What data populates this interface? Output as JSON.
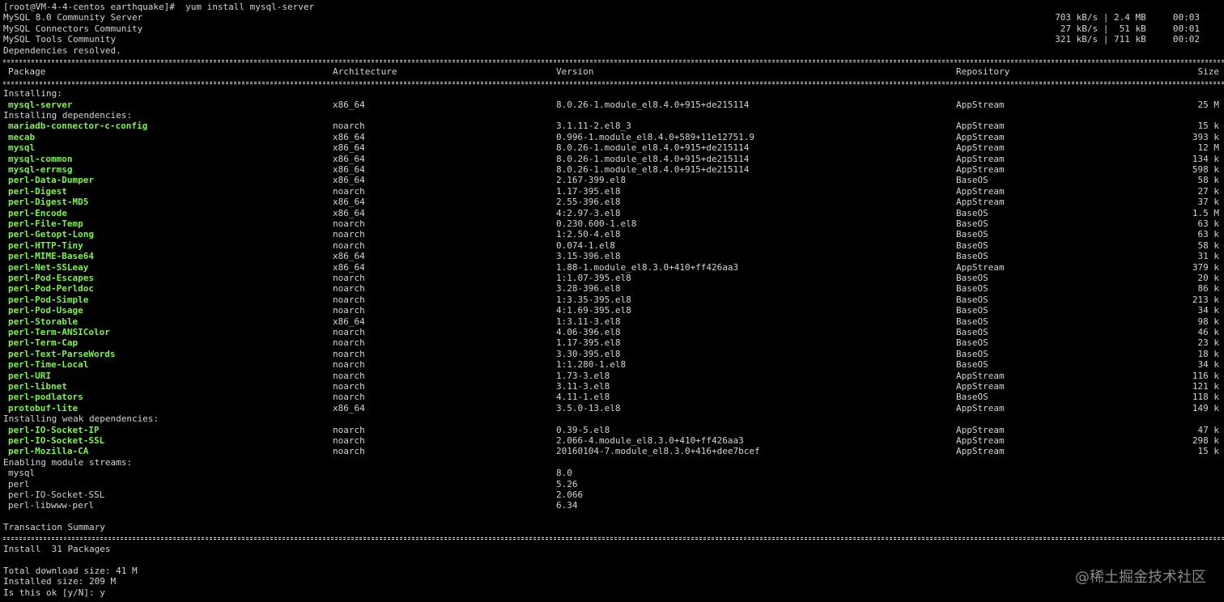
{
  "prompt_line": "[root@VM-4-4-centos earthquake]#  yum install mysql-server",
  "repos": [
    {
      "name": "MySQL 8.0 Community Server",
      "stats": "703 kB/s | 2.4 MB     00:03"
    },
    {
      "name": "MySQL Connectors Community",
      "stats": " 27 kB/s |  51 kB     00:01"
    },
    {
      "name": "MySQL Tools Community",
      "stats": "321 kB/s | 711 kB     00:02"
    }
  ],
  "deps_resolved": "Dependencies resolved.",
  "headers": {
    "package": "Package",
    "arch": "Architecture",
    "version": "Version",
    "repo": "Repository",
    "size": "Size"
  },
  "section_installing": "Installing:",
  "installing": [
    {
      "name": "mysql-server",
      "arch": "x86_64",
      "version": "8.0.26-1.module_el8.4.0+915+de215114",
      "repo": "AppStream",
      "size": "25 M"
    }
  ],
  "section_deps": "Installing dependencies:",
  "deps": [
    {
      "name": "mariadb-connector-c-config",
      "arch": "noarch",
      "version": "3.1.11-2.el8_3",
      "repo": "AppStream",
      "size": "15 k"
    },
    {
      "name": "mecab",
      "arch": "x86_64",
      "version": "0.996-1.module_el8.4.0+589+11e12751.9",
      "repo": "AppStream",
      "size": "393 k"
    },
    {
      "name": "mysql",
      "arch": "x86_64",
      "version": "8.0.26-1.module_el8.4.0+915+de215114",
      "repo": "AppStream",
      "size": "12 M"
    },
    {
      "name": "mysql-common",
      "arch": "x86_64",
      "version": "8.0.26-1.module_el8.4.0+915+de215114",
      "repo": "AppStream",
      "size": "134 k"
    },
    {
      "name": "mysql-errmsg",
      "arch": "x86_64",
      "version": "8.0.26-1.module_el8.4.0+915+de215114",
      "repo": "AppStream",
      "size": "598 k"
    },
    {
      "name": "perl-Data-Dumper",
      "arch": "x86_64",
      "version": "2.167-399.el8",
      "repo": "BaseOS",
      "size": "58 k"
    },
    {
      "name": "perl-Digest",
      "arch": "noarch",
      "version": "1.17-395.el8",
      "repo": "AppStream",
      "size": "27 k"
    },
    {
      "name": "perl-Digest-MD5",
      "arch": "x86_64",
      "version": "2.55-396.el8",
      "repo": "AppStream",
      "size": "37 k"
    },
    {
      "name": "perl-Encode",
      "arch": "x86_64",
      "version": "4:2.97-3.el8",
      "repo": "BaseOS",
      "size": "1.5 M"
    },
    {
      "name": "perl-File-Temp",
      "arch": "noarch",
      "version": "0.230.600-1.el8",
      "repo": "BaseOS",
      "size": "63 k"
    },
    {
      "name": "perl-Getopt-Long",
      "arch": "noarch",
      "version": "1:2.50-4.el8",
      "repo": "BaseOS",
      "size": "63 k"
    },
    {
      "name": "perl-HTTP-Tiny",
      "arch": "noarch",
      "version": "0.074-1.el8",
      "repo": "BaseOS",
      "size": "58 k"
    },
    {
      "name": "perl-MIME-Base64",
      "arch": "x86_64",
      "version": "3.15-396.el8",
      "repo": "BaseOS",
      "size": "31 k"
    },
    {
      "name": "perl-Net-SSLeay",
      "arch": "x86_64",
      "version": "1.88-1.module_el8.3.0+410+ff426aa3",
      "repo": "AppStream",
      "size": "379 k"
    },
    {
      "name": "perl-Pod-Escapes",
      "arch": "noarch",
      "version": "1:1.07-395.el8",
      "repo": "BaseOS",
      "size": "20 k"
    },
    {
      "name": "perl-Pod-Perldoc",
      "arch": "noarch",
      "version": "3.28-396.el8",
      "repo": "BaseOS",
      "size": "86 k"
    },
    {
      "name": "perl-Pod-Simple",
      "arch": "noarch",
      "version": "1:3.35-395.el8",
      "repo": "BaseOS",
      "size": "213 k"
    },
    {
      "name": "perl-Pod-Usage",
      "arch": "noarch",
      "version": "4:1.69-395.el8",
      "repo": "BaseOS",
      "size": "34 k"
    },
    {
      "name": "perl-Storable",
      "arch": "x86_64",
      "version": "1:3.11-3.el8",
      "repo": "BaseOS",
      "size": "98 k"
    },
    {
      "name": "perl-Term-ANSIColor",
      "arch": "noarch",
      "version": "4.06-396.el8",
      "repo": "BaseOS",
      "size": "46 k"
    },
    {
      "name": "perl-Term-Cap",
      "arch": "noarch",
      "version": "1.17-395.el8",
      "repo": "BaseOS",
      "size": "23 k"
    },
    {
      "name": "perl-Text-ParseWords",
      "arch": "noarch",
      "version": "3.30-395.el8",
      "repo": "BaseOS",
      "size": "18 k"
    },
    {
      "name": "perl-Time-Local",
      "arch": "noarch",
      "version": "1:1.280-1.el8",
      "repo": "BaseOS",
      "size": "34 k"
    },
    {
      "name": "perl-URI",
      "arch": "noarch",
      "version": "1.73-3.el8",
      "repo": "AppStream",
      "size": "116 k"
    },
    {
      "name": "perl-libnet",
      "arch": "noarch",
      "version": "3.11-3.el8",
      "repo": "AppStream",
      "size": "121 k"
    },
    {
      "name": "perl-podlators",
      "arch": "noarch",
      "version": "4.11-1.el8",
      "repo": "BaseOS",
      "size": "118 k"
    },
    {
      "name": "protobuf-lite",
      "arch": "x86_64",
      "version": "3.5.0-13.el8",
      "repo": "AppStream",
      "size": "149 k"
    }
  ],
  "section_weak": "Installing weak dependencies:",
  "weak": [
    {
      "name": "perl-IO-Socket-IP",
      "arch": "noarch",
      "version": "0.39-5.el8",
      "repo": "AppStream",
      "size": "47 k"
    },
    {
      "name": "perl-IO-Socket-SSL",
      "arch": "noarch",
      "version": "2.066-4.module_el8.3.0+410+ff426aa3",
      "repo": "AppStream",
      "size": "298 k"
    },
    {
      "name": "perl-Mozilla-CA",
      "arch": "noarch",
      "version": "20160104-7.module_el8.3.0+416+dee7bcef",
      "repo": "AppStream",
      "size": "15 k"
    }
  ],
  "section_streams": "Enabling module streams:",
  "streams": [
    {
      "name": "mysql",
      "version": "8.0"
    },
    {
      "name": "perl",
      "version": "5.26"
    },
    {
      "name": "perl-IO-Socket-SSL",
      "version": "2.066"
    },
    {
      "name": "perl-libwww-perl",
      "version": "6.34"
    }
  ],
  "summary_title": "Transaction Summary",
  "install_line": "Install  31 Packages",
  "download_size": "Total download size: 41 M",
  "installed_size": "Installed size: 209 M",
  "confirm_prompt": "Is this ok [y/N]: y",
  "watermark": "@稀土掘金技术社区",
  "colors": {
    "background": "#000000",
    "text": "#d4d4d4",
    "package": "#7cf54a"
  }
}
